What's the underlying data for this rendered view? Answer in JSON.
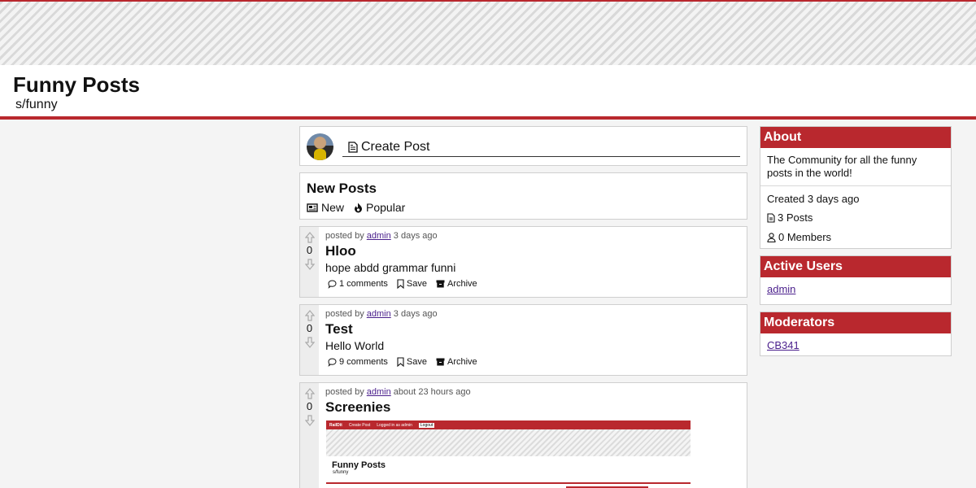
{
  "header": {
    "title": "Funny Posts",
    "subreddit": "s/funny"
  },
  "create_post": {
    "label": "Create Post"
  },
  "new_posts": {
    "title": "New Posts",
    "sort_new": "New",
    "sort_popular": "Popular"
  },
  "posts": [
    {
      "posted_by": "posted by",
      "author": "admin",
      "time": "3 days ago",
      "score": "0",
      "title": "Hloo",
      "body": "hope abdd grammar funni",
      "comments": "1 comments",
      "save": "Save",
      "archive": "Archive"
    },
    {
      "posted_by": "posted by",
      "author": "admin",
      "time": "3 days ago",
      "score": "0",
      "title": "Test",
      "body": "Hello World",
      "comments": "9 comments",
      "save": "Save",
      "archive": "Archive"
    },
    {
      "posted_by": "posted by",
      "author": "admin",
      "time": "about 23 hours ago",
      "score": "0",
      "title": "Screenies",
      "screenshot": {
        "brand": "RailDit",
        "create": "Create Post",
        "logged_in": "Logged in as admin",
        "logout": "Logout",
        "title": "Funny Posts",
        "sub": "s/funny"
      }
    }
  ],
  "about": {
    "heading": "About",
    "description": "The Community for all the funny posts in the world!",
    "created": "Created 3 days ago",
    "posts": "3 Posts",
    "members": "0 Members"
  },
  "active_users": {
    "heading": "Active Users",
    "users": [
      "admin"
    ]
  },
  "moderators": {
    "heading": "Moderators",
    "users": [
      "CB341"
    ]
  },
  "colors": {
    "accent": "#b9282e",
    "link": "#4a1f8c"
  }
}
